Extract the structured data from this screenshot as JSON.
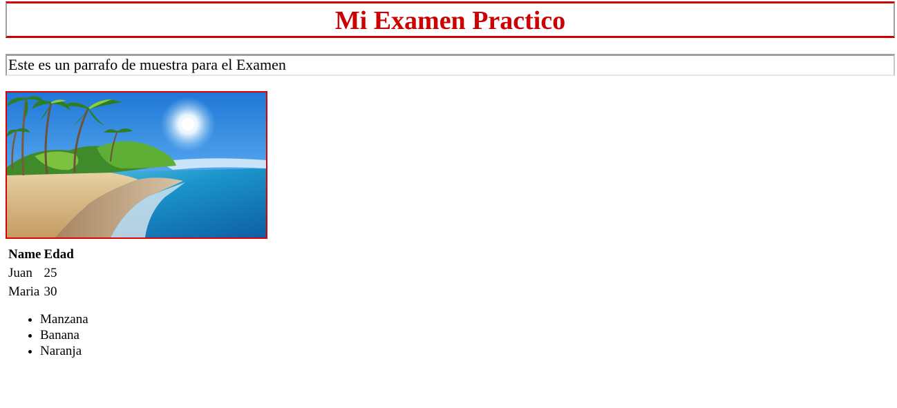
{
  "header": {
    "title": "Mi Examen Practico"
  },
  "intro": {
    "text": "Este es un parrafo de muestra para el Examen"
  },
  "image": {
    "subject": "tropical-beach-photo"
  },
  "table": {
    "headers": [
      "Name",
      "Edad"
    ],
    "rows": [
      [
        "Juan",
        "25"
      ],
      [
        "Maria",
        "30"
      ]
    ]
  },
  "fruits": [
    "Manzana",
    "Banana",
    "Naranja"
  ],
  "colors": {
    "accent": "#cc0000",
    "border_gray": "#a0a0a0"
  }
}
